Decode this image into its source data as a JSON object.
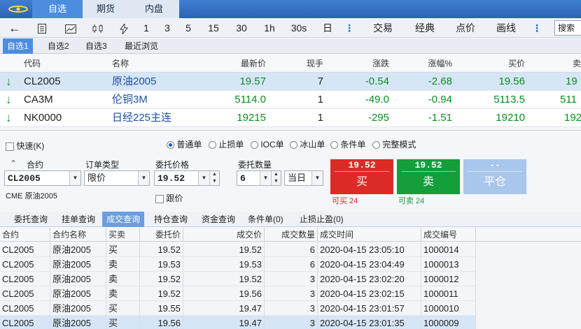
{
  "top_tabs": [
    "自选",
    "期货",
    "内盘"
  ],
  "toolbar": {
    "periods": [
      "1",
      "3",
      "5",
      "15",
      "30",
      "1h",
      "30s",
      "日"
    ],
    "menus": [
      "交易",
      "经典",
      "点价",
      "画线"
    ],
    "search_label": "搜索"
  },
  "watch_tabs": [
    "自选1",
    "自选2",
    "自选3",
    "最近浏览"
  ],
  "quote_headers": {
    "code": "代码",
    "name": "名称",
    "last": "最新价",
    "hand": "现手",
    "change": "涨跌",
    "pct": "涨幅%",
    "bid": "买价",
    "ask": "卖"
  },
  "quotes": [
    {
      "code": "CL2005",
      "name": "原油2005",
      "last": "19.57",
      "hand": "7",
      "change": "-0.54",
      "pct": "-2.68",
      "bid": "19.56",
      "ask": "19"
    },
    {
      "code": "CA3M",
      "name": "伦铜3M",
      "last": "5114.0",
      "hand": "1",
      "change": "-49.0",
      "pct": "-0.94",
      "bid": "5113.5",
      "ask": "511"
    },
    {
      "code": "NK0000",
      "name": "日经225主连",
      "last": "19215",
      "hand": "1",
      "change": "-295",
      "pct": "-1.51",
      "bid": "19210",
      "ask": "192"
    }
  ],
  "order_panel": {
    "quick_label": "快速(K)",
    "order_types": [
      {
        "label": "普通单",
        "selected": true
      },
      {
        "label": "止损单",
        "selected": false
      },
      {
        "label": "IOC单",
        "selected": false
      },
      {
        "label": "冰山单",
        "selected": false
      },
      {
        "label": "条件单",
        "selected": false
      },
      {
        "label": "完整模式",
        "selected": false
      }
    ],
    "contract_label": "合约",
    "contract_value": "CL2005",
    "contract_desc": "CME 原油2005",
    "order_type_label": "订单类型",
    "order_type_value": "限价",
    "price_label": "委托价格",
    "price_value": "19.52",
    "follow_label": "跟价",
    "qty_label": "委托数量",
    "qty_value": "6",
    "tif_value": "当日",
    "buy": {
      "price": "19.52",
      "label": "买",
      "avail": "可买 24",
      "color": "#dd2a26"
    },
    "sell": {
      "price": "19.52",
      "label": "卖",
      "avail": "可卖 24",
      "color": "#149e3c"
    },
    "close": {
      "price": "--",
      "label": "平仓",
      "color": "#a9c6ec"
    }
  },
  "bottom_tabs": [
    "委托查询",
    "挂单查询",
    "成交查询",
    "持仓查询",
    "资金查询",
    "条件单(0)",
    "止损止盈(0)"
  ],
  "trade_headers": [
    "合约",
    "合约名称",
    "买卖",
    "委托价",
    "成交价",
    "成交数量",
    "成交时间",
    "成交编号"
  ],
  "trades": [
    [
      "CL2005",
      "原油2005",
      "买",
      "19.52",
      "19.52",
      "6",
      "2020-04-15 23:05:10",
      "1000014"
    ],
    [
      "CL2005",
      "原油2005",
      "卖",
      "19.53",
      "19.53",
      "6",
      "2020-04-15 23:04:49",
      "1000013"
    ],
    [
      "CL2005",
      "原油2005",
      "卖",
      "19.52",
      "19.52",
      "3",
      "2020-04-15 23:02:20",
      "1000012"
    ],
    [
      "CL2005",
      "原油2005",
      "卖",
      "19.52",
      "19.56",
      "3",
      "2020-04-15 23:02:15",
      "1000011"
    ],
    [
      "CL2005",
      "原油2005",
      "买",
      "19.55",
      "19.47",
      "3",
      "2020-04-15 23:01:57",
      "1000010"
    ],
    [
      "CL2005",
      "原油2005",
      "买",
      "19.56",
      "19.47",
      "3",
      "2020-04-15 23:01:35",
      "1000009"
    ]
  ]
}
